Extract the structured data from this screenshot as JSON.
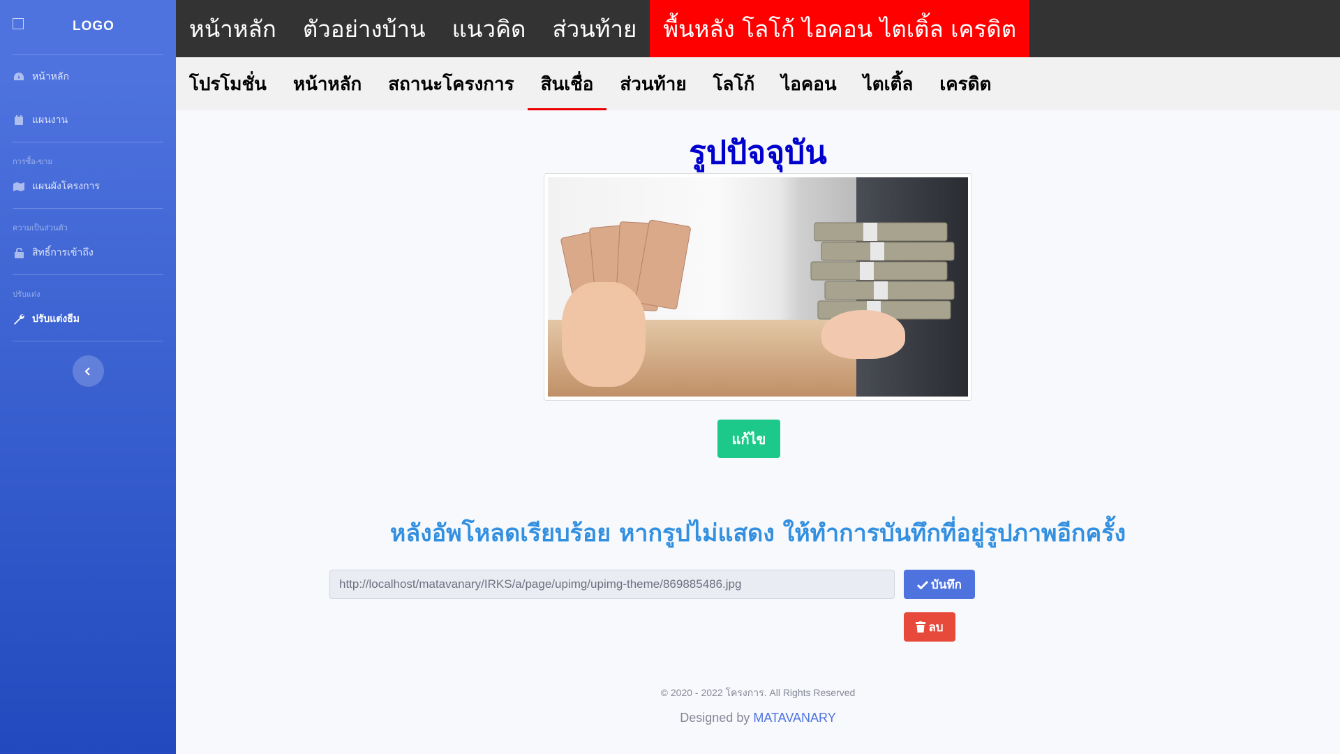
{
  "sidebar": {
    "brand": "LOGO",
    "items": [
      {
        "label": "หน้าหลัก",
        "icon": "dashboard-icon"
      },
      {
        "label": "แผนงาน",
        "icon": "calendar-icon"
      }
    ],
    "sections": [
      {
        "heading": "การซื้อ-ขาย",
        "items": [
          {
            "label": "แผนผังโครงการ",
            "icon": "map-icon"
          }
        ]
      },
      {
        "heading": "ความเป็นส่วนตัว",
        "items": [
          {
            "label": "สิทธิ์การเข้าถึง",
            "icon": "lock-icon"
          }
        ]
      },
      {
        "heading": "ปรับแต่ง",
        "items": [
          {
            "label": "ปรับแต่งธีม",
            "icon": "wrench-icon",
            "active": true
          }
        ]
      }
    ],
    "toggle_icon": "chevron-left-icon"
  },
  "topnav": {
    "items": [
      "หน้าหลัก",
      "ตัวอย่างบ้าน",
      "แนวคิด",
      "ส่วนท้าย",
      "พื้นหลัง โลโก้ ไอคอน ไตเติ้ล เครดิต"
    ],
    "highlight_index": 4,
    "highlight_color": "#ff0000"
  },
  "subnav": {
    "items": [
      "โปรโมชั่น",
      "หน้าหลัก",
      "สถานะโครงการ",
      "สินเชื่อ",
      "ส่วนท้าย",
      "โลโก้",
      "ไอคอน",
      "ไตเติ้ล",
      "เครดิต"
    ],
    "active_index": 3
  },
  "main": {
    "title": "รูปปัจจุบัน",
    "edit_label": "แก้ไข",
    "notice": "หลังอัพโหลดเรียบร้อย หากรูปไม่แสดง ให้ทำการบันทึกที่อยู่รูปภาพอีกครั้ง",
    "url_value": "http://localhost/matavanary/IRKS/a/page/upimg/upimg-theme/869885486.jpg",
    "save_label": "บันทึก",
    "delete_label": "ลบ"
  },
  "footer": {
    "copyright": "© 2020 - 2022 โครงการ. All Rights Reserved",
    "designed_by": "Designed by",
    "designer": "MATAVANARY"
  },
  "colors": {
    "sidebar_gradient_start": "#4e73df",
    "sidebar_gradient_end": "#224abe",
    "title": "#0000cd",
    "notice": "#3390e0",
    "edit_button": "#1cc88a",
    "save_button": "#4e73df",
    "delete_button": "#e74a3b"
  }
}
